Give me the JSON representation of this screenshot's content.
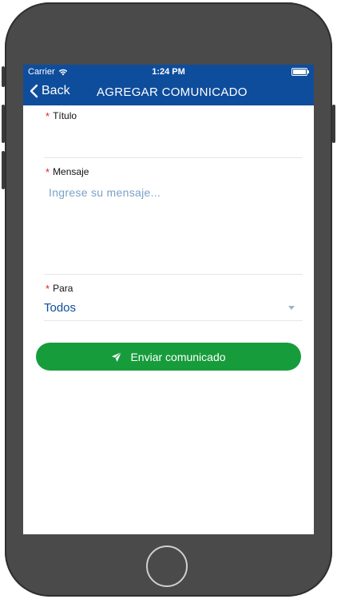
{
  "status_bar": {
    "carrier": "Carrier",
    "time": "1:24 PM",
    "icons": [
      "wifi-icon",
      "battery-icon"
    ]
  },
  "nav_bar": {
    "back_label": "Back",
    "title": "AGREGAR COMUNICADO"
  },
  "form": {
    "title_field": {
      "required_mark": "*",
      "label": "Título",
      "value": ""
    },
    "message_field": {
      "required_mark": "*",
      "label": "Mensaje",
      "placeholder": "Ingrese su mensaje..."
    },
    "recipient_field": {
      "required_mark": "*",
      "label": "Para",
      "selected": "Todos"
    }
  },
  "send_button": {
    "label": "Enviar comunicado",
    "icon": "send-icon"
  },
  "colors": {
    "header_blue": "#0e4d9c",
    "send_green": "#179c3c",
    "required_red": "#dd2222",
    "placeholder_blue": "#7aa0c8",
    "device_gray": "#4a4a4a"
  }
}
